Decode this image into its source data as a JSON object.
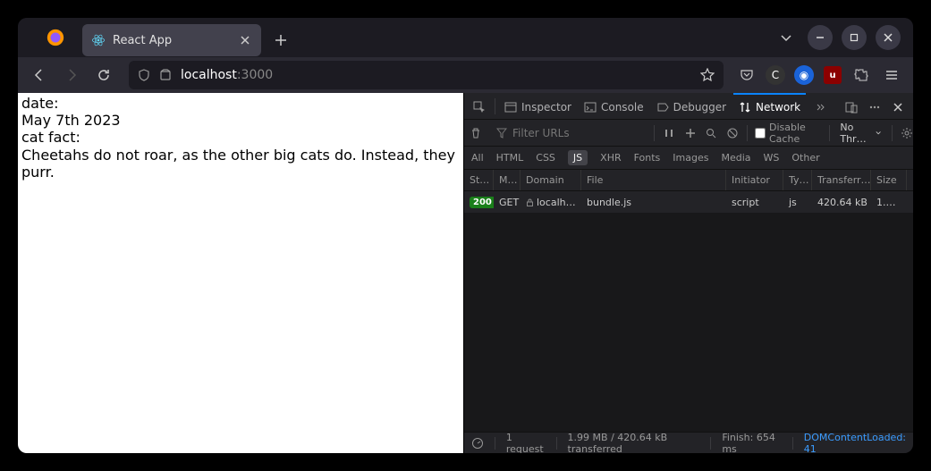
{
  "tab": {
    "title": "React App"
  },
  "url": {
    "host": "localhost",
    "path": ":3000"
  },
  "page": {
    "date_label": "date:",
    "date_value": "May 7th 2023",
    "fact_label": "cat fact:",
    "fact_value": "Cheetahs do not roar, as the other big cats do. Instead, they purr."
  },
  "devtools": {
    "tabs": {
      "inspector": "Inspector",
      "console": "Console",
      "debugger": "Debugger",
      "network": "Network"
    },
    "filter_placeholder": "Filter URLs",
    "disable_cache": "Disable Cache",
    "throttling": "No Thr…",
    "filters": {
      "all": "All",
      "html": "HTML",
      "css": "CSS",
      "js": "JS",
      "xhr": "XHR",
      "fonts": "Fonts",
      "images": "Images",
      "media": "Media",
      "ws": "WS",
      "other": "Other"
    },
    "headers": {
      "status": "St…",
      "method": "M…",
      "domain": "Domain",
      "file": "File",
      "initiator": "Initiator",
      "type": "Ty…",
      "transferred": "Transferr…",
      "size": "Size"
    },
    "rows": [
      {
        "status": "200",
        "method": "GET",
        "domain": "localh…",
        "file": "bundle.js",
        "initiator": "script",
        "type": "js",
        "transferred": "420.64 kB",
        "size": "1.…"
      }
    ],
    "status": {
      "requests": "1 request",
      "transferred": "1.99 MB / 420.64 kB transferred",
      "finish": "Finish: 654 ms",
      "dom": "DOMContentLoaded: 41"
    }
  }
}
